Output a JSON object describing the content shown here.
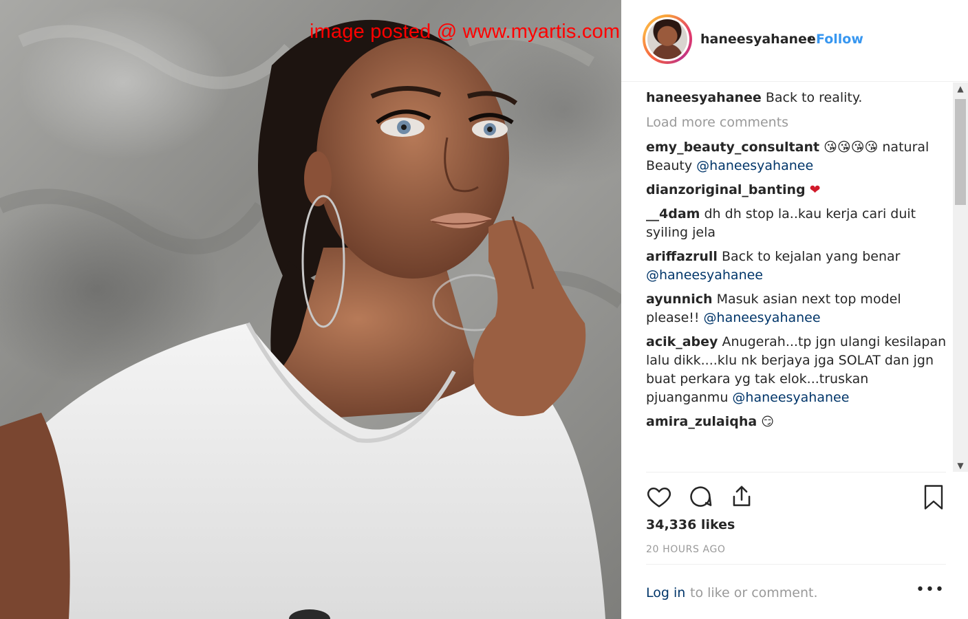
{
  "watermark": "image posted @ www.myartis.com",
  "post": {
    "username": "haneesyahanee",
    "separator": "•",
    "follow_label": "Follow",
    "caption": {
      "username": "haneesyahanee",
      "text": "Back to reality."
    },
    "load_more_label": "Load more comments",
    "comments": [
      {
        "username": "emy_beauty_consultant",
        "text": "😘😘😘😘 natural Beauty ",
        "mention": "@haneesyahanee"
      },
      {
        "username": "dianzoriginal_banting",
        "emoji": "❤"
      },
      {
        "username": "__4dam",
        "text": "dh dh stop la..kau kerja cari duit syiling jela"
      },
      {
        "username": "ariffazrull",
        "text": "Back to kejalan yang benar ",
        "mention": "@haneesyahanee"
      },
      {
        "username": "ayunnich",
        "text": "Masuk asian next top model please!! ",
        "mention": "@haneesyahanee"
      },
      {
        "username": "acik_abey",
        "text": "Anugerah...tp jgn ulangi kesilapan lalu dikk....klu nk berjaya jga SOLAT dan jgn buat perkara yg tak elok...truskan pjuanganmu ",
        "mention": "@haneesyahanee"
      },
      {
        "username": "amira_zulaiqha",
        "emoji": "😏"
      }
    ],
    "likes": "34,336 likes",
    "time_ago": "20 HOURS AGO",
    "login_link": "Log in",
    "login_rest": "to like or comment.",
    "more_options": "•••"
  },
  "icons": {
    "like": "heart-icon",
    "comment": "comment-icon",
    "share": "share-icon",
    "save": "bookmark-icon"
  },
  "colors": {
    "follow": "#3897f0",
    "mention": "#003569",
    "muted": "#999999",
    "text": "#262626",
    "watermark": "#ff0000"
  }
}
